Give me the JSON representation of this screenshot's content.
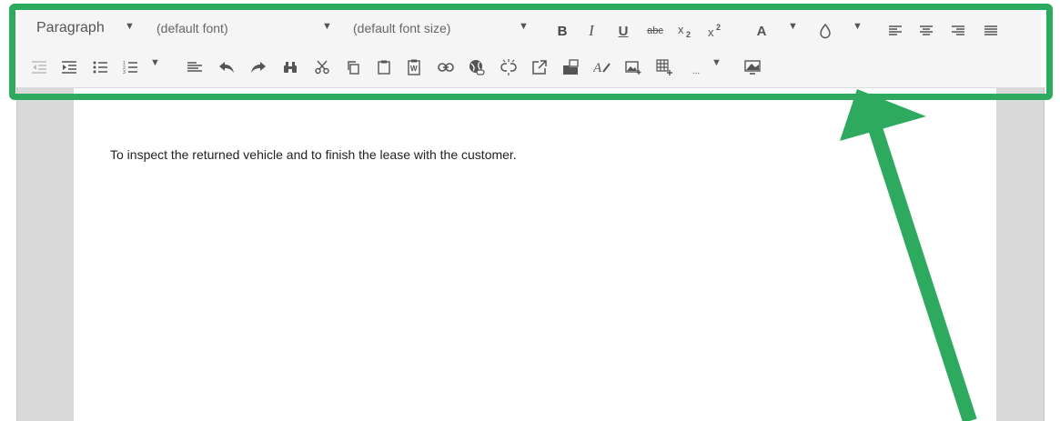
{
  "toolbar": {
    "block_format": "Paragraph",
    "font_family": "(default font)",
    "font_size": "(default font size)",
    "bold_label": "B",
    "italic_label": "I",
    "underline_label": "U",
    "strike_label": "abc",
    "font_color_label": "A",
    "more_label": "..."
  },
  "editor": {
    "content": "To inspect the returned vehicle and to finish the lease with the customer."
  },
  "colors": {
    "highlight": "#2eaa5f",
    "toolbar_bg": "#f5f5f5",
    "icon": "#555555"
  },
  "icons": [
    "outdent-icon",
    "indent-icon",
    "bullet-list-icon",
    "numbered-list-icon",
    "align-icon",
    "undo-icon",
    "redo-icon",
    "find-icon",
    "cut-icon",
    "copy-icon",
    "paste-icon",
    "paste-word-icon",
    "link-icon",
    "link-globe-icon",
    "unlink-icon",
    "external-link-icon",
    "file-manager-icon",
    "spellcheck-icon",
    "image-icon",
    "table-icon",
    "more-icon",
    "preview-icon"
  ]
}
